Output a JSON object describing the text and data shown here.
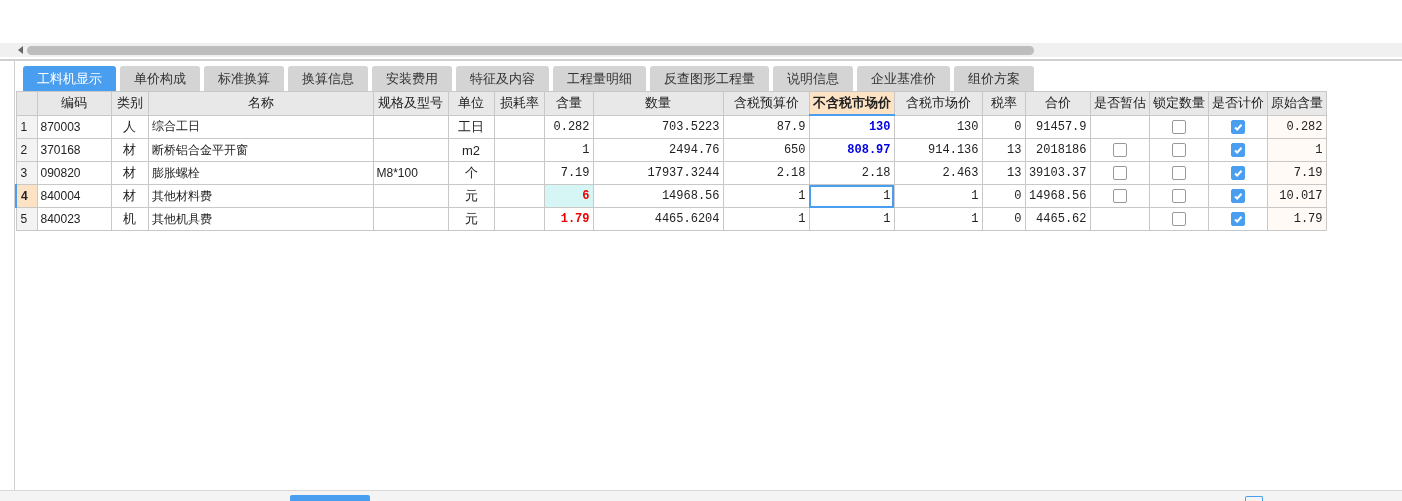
{
  "tabs": [
    {
      "label": "工料机显示",
      "selected": true
    },
    {
      "label": "单价构成",
      "selected": false
    },
    {
      "label": "标准换算",
      "selected": false
    },
    {
      "label": "换算信息",
      "selected": false
    },
    {
      "label": "安装费用",
      "selected": false
    },
    {
      "label": "特征及内容",
      "selected": false
    },
    {
      "label": "工程量明细",
      "selected": false
    },
    {
      "label": "反查图形工程量",
      "selected": false
    },
    {
      "label": "说明信息",
      "selected": false
    },
    {
      "label": "企业基准价",
      "selected": false
    },
    {
      "label": "组价方案",
      "selected": false
    }
  ],
  "table": {
    "columns": [
      {
        "label": "编码",
        "selected": false
      },
      {
        "label": "类别",
        "selected": false
      },
      {
        "label": "名称",
        "selected": false
      },
      {
        "label": "规格及型号",
        "selected": false
      },
      {
        "label": "单位",
        "selected": false
      },
      {
        "label": "损耗率",
        "selected": false
      },
      {
        "label": "含量",
        "selected": false
      },
      {
        "label": "数量",
        "selected": false
      },
      {
        "label": "含税预算价",
        "selected": false
      },
      {
        "label": "不含税市场价",
        "selected": true
      },
      {
        "label": "含税市场价",
        "selected": false
      },
      {
        "label": "税率",
        "selected": false
      },
      {
        "label": "合价",
        "selected": false
      },
      {
        "label": "是否暂估",
        "selected": false
      },
      {
        "label": "锁定数量",
        "selected": false
      },
      {
        "label": "是否计价",
        "selected": false
      },
      {
        "label": "原始含量",
        "selected": false
      }
    ],
    "rows": [
      {
        "number": "1",
        "selected": false,
        "code": "870003",
        "category": "人",
        "name": "综合工日",
        "spec": "",
        "unit": "工日",
        "content": "0.282",
        "content_modified": false,
        "quantity": "703.5223",
        "budget_price": "87.9",
        "market_price": "130",
        "price_modified": true,
        "market_price_tax": "130",
        "tax_rate": "0",
        "total": "91457.9",
        "lock_quantity": false,
        "priced": true,
        "original_content": "0.282"
      },
      {
        "number": "2",
        "selected": false,
        "code": "370168",
        "category": "材",
        "name": "断桥铝合金平开窗",
        "spec": "",
        "unit": "m2",
        "content": "1",
        "content_modified": false,
        "quantity": "2494.76",
        "budget_price": "650",
        "market_price": "808.97",
        "price_modified": true,
        "market_price_tax": "914.136",
        "tax_rate": "13",
        "total": "2018186",
        "estimate": false,
        "lock_quantity": false,
        "priced": true,
        "original_content": "1"
      },
      {
        "number": "3",
        "selected": false,
        "code": "090820",
        "category": "材",
        "name": "膨胀螺栓",
        "spec": "M8*100",
        "unit": "个",
        "content": "7.19",
        "content_modified": false,
        "quantity": "17937.3244",
        "budget_price": "2.18",
        "market_price": "2.18",
        "price_modified": false,
        "market_price_tax": "2.463",
        "tax_rate": "13",
        "total": "39103.37",
        "estimate": false,
        "lock_quantity": false,
        "priced": true,
        "original_content": "7.19"
      },
      {
        "number": "4",
        "selected": true,
        "code": "840004",
        "category": "材",
        "name": "其他材料费",
        "spec": "",
        "unit": "元",
        "content": "6",
        "content_modified": true,
        "quantity": "14968.56",
        "budget_price": "1",
        "market_price": "1",
        "price_modified": false,
        "market_price_tax": "1",
        "tax_rate": "0",
        "total": "14968.56",
        "estimate": false,
        "lock_quantity": false,
        "priced": true,
        "original_content": "10.017"
      },
      {
        "number": "5",
        "selected": false,
        "code": "840023",
        "category": "机",
        "name": "其他机具费",
        "spec": "",
        "unit": "元",
        "content": "1.79",
        "content_modified": true,
        "quantity": "4465.6204",
        "budget_price": "1",
        "market_price": "1",
        "price_modified": false,
        "market_price_tax": "1",
        "tax_rate": "0",
        "total": "4465.62",
        "lock_quantity": false,
        "priced": true,
        "original_content": "1.79"
      }
    ]
  }
}
